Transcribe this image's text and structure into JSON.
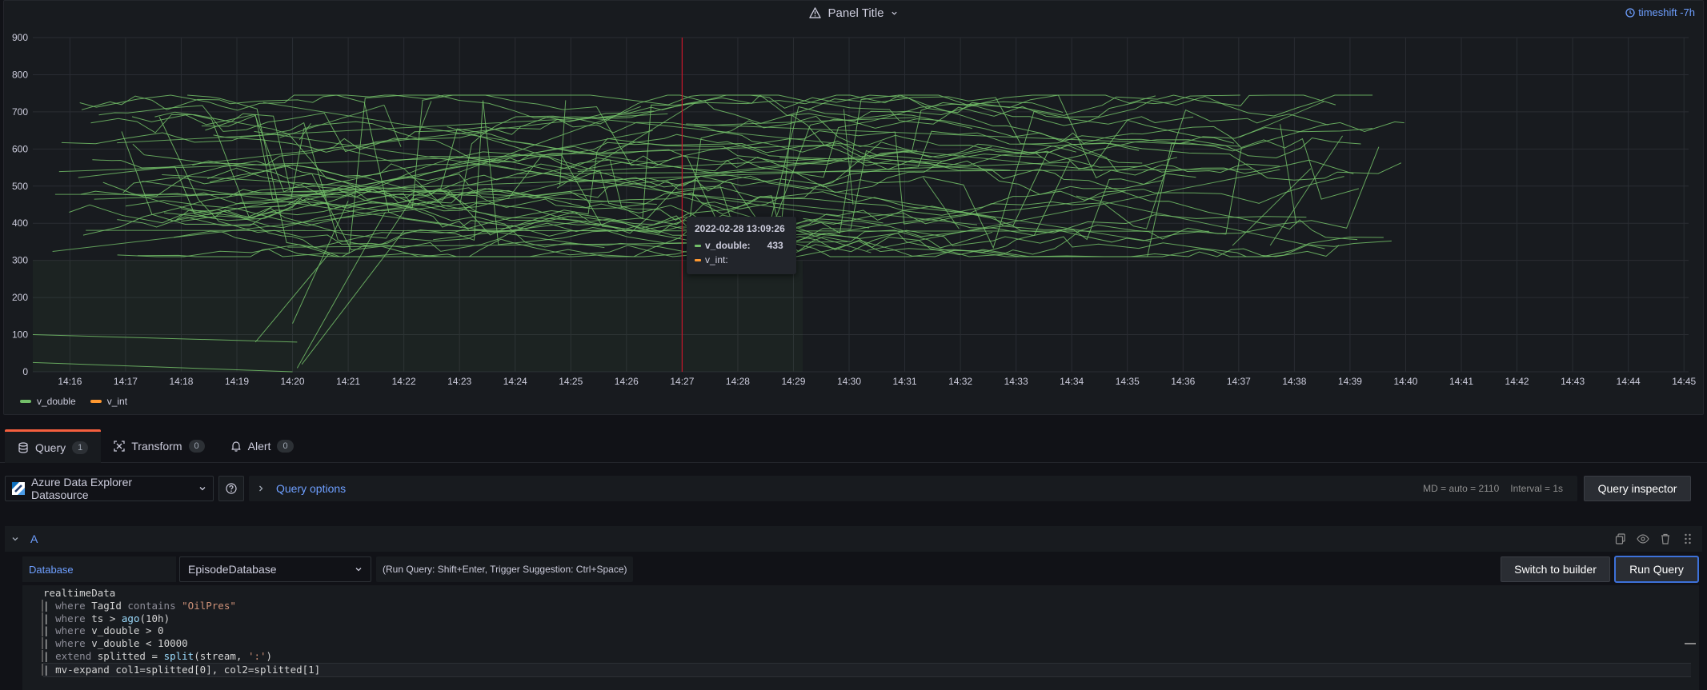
{
  "panel": {
    "title": "Panel Title",
    "timeshift": "timeshift -7h",
    "colors": {
      "v_double": "#73bf69",
      "v_int": "#ff9830",
      "crosshair": "#c4162a"
    }
  },
  "chart_data": {
    "type": "line",
    "y_ticks": [
      "900",
      "800",
      "700",
      "600",
      "500",
      "400",
      "300",
      "200",
      "100",
      "0"
    ],
    "ylim": [
      0,
      900
    ],
    "x_ticks": [
      "14:16",
      "14:17",
      "14:18",
      "14:19",
      "14:20",
      "14:21",
      "14:22",
      "14:23",
      "14:24",
      "14:25",
      "14:26",
      "14:27",
      "14:28",
      "14:29",
      "14:30",
      "14:31",
      "14:32",
      "14:33",
      "14:34",
      "14:35",
      "14:36",
      "14:37",
      "14:38",
      "14:39",
      "14:40",
      "14:41",
      "14:42",
      "14:43",
      "14:44",
      "14:45"
    ],
    "xlim": [
      "14:15:20",
      "14:45:05"
    ],
    "grid": true,
    "legend_placement": "bottom-left",
    "series": [
      {
        "name": "v_double",
        "color": "#73bf69"
      },
      {
        "name": "v_int",
        "color": "#ff9830"
      }
    ]
  },
  "tooltip": {
    "time": "2022-02-28 13:09:26",
    "rows": [
      {
        "name": "v_double:",
        "value": "433",
        "color": "#73bf69"
      },
      {
        "name": "v_int:",
        "value": "",
        "color": "#ff9830"
      }
    ]
  },
  "tabs": [
    {
      "label": "Query",
      "count": "1",
      "icon": "database-icon"
    },
    {
      "label": "Transform",
      "count": "0",
      "icon": "transform-icon"
    },
    {
      "label": "Alert",
      "count": "0",
      "icon": "bell-icon"
    }
  ],
  "datasource": {
    "name": "Azure Data Explorer Datasource",
    "query_options": "Query options",
    "md": "MD = auto = 2110",
    "interval": "Interval = 1s",
    "inspector": "Query inspector"
  },
  "query": {
    "ref_id": "A",
    "database_label": "Database",
    "database_value": "EpisodeDatabase",
    "run_hint": "(Run Query: Shift+Enter, Trigger Suggestion: Ctrl+Space)",
    "switch_label": "Switch to builder",
    "run_label": "Run Query",
    "code": [
      "realtimeData",
      "| where TagId contains \"OilPres\"",
      "| where ts > ago(10h)",
      "| where v_double > 0",
      "| where v_double < 10000",
      "| extend splitted = split(stream, ':')",
      "| mv-expand col1=splitted[0], col2=splitted[1]"
    ]
  }
}
